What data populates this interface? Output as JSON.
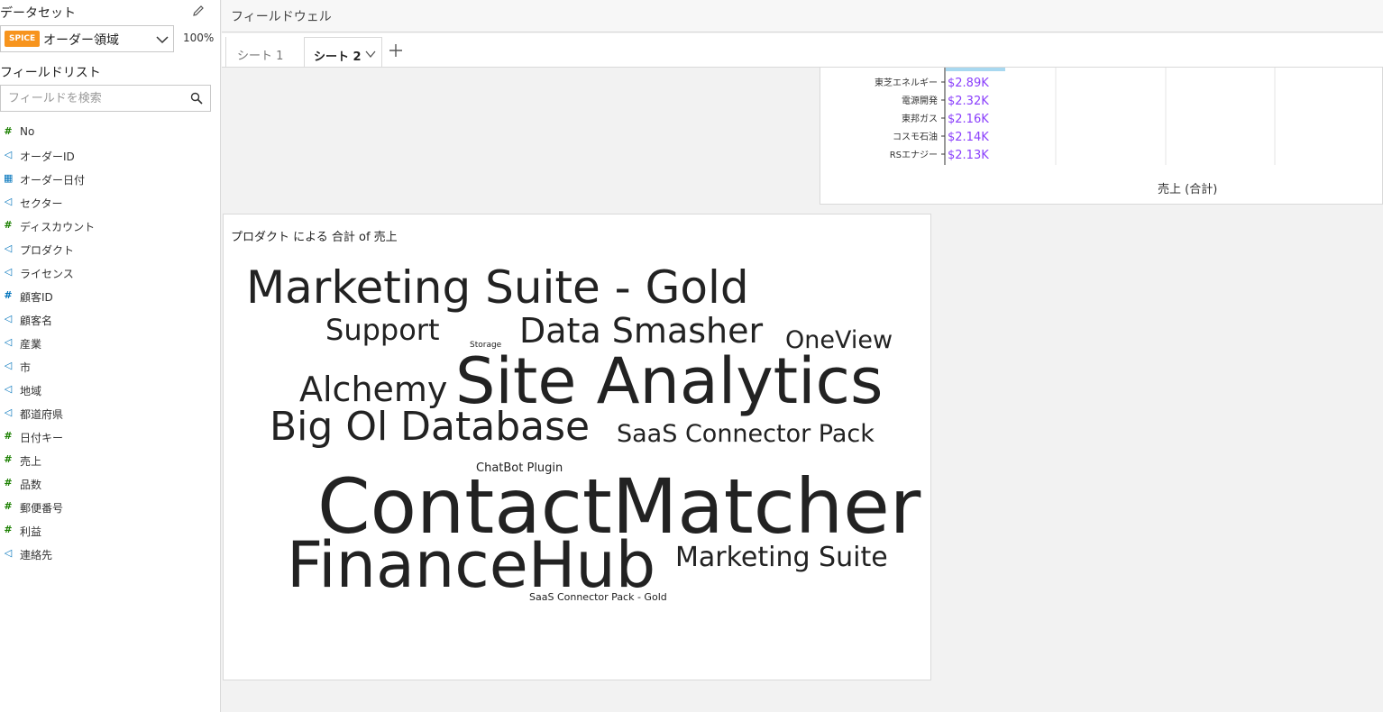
{
  "sidebar": {
    "dataset_title": "データセット",
    "dataset": {
      "badge": "SPICE",
      "name": "オーダー領域",
      "import_percent": "100%"
    },
    "field_list_title": "フィールドリスト",
    "search_placeholder": "フィールドを検索",
    "fields": [
      {
        "label": "No",
        "type": "measure",
        "icon": "hash-icon"
      },
      {
        "label": "オーダーID",
        "type": "dimension",
        "icon": "tag-icon"
      },
      {
        "label": "オーダー日付",
        "type": "date",
        "icon": "calendar-icon"
      },
      {
        "label": "セクター",
        "type": "dimension",
        "icon": "tag-icon"
      },
      {
        "label": "ディスカウント",
        "type": "measure",
        "icon": "hash-icon"
      },
      {
        "label": "プロダクト",
        "type": "dimension",
        "icon": "tag-icon"
      },
      {
        "label": "ライセンス",
        "type": "dimension",
        "icon": "tag-icon"
      },
      {
        "label": "顧客ID",
        "type": "dimension-numeric",
        "icon": "hash-icon"
      },
      {
        "label": "顧客名",
        "type": "dimension",
        "icon": "tag-icon"
      },
      {
        "label": "産業",
        "type": "dimension",
        "icon": "tag-icon"
      },
      {
        "label": "市",
        "type": "dimension",
        "icon": "tag-icon"
      },
      {
        "label": "地域",
        "type": "dimension",
        "icon": "tag-icon"
      },
      {
        "label": "都道府県",
        "type": "dimension",
        "icon": "tag-icon"
      },
      {
        "label": "日付キー",
        "type": "measure",
        "icon": "hash-icon"
      },
      {
        "label": "売上",
        "type": "measure",
        "icon": "hash-icon"
      },
      {
        "label": "品数",
        "type": "measure",
        "icon": "hash-icon"
      },
      {
        "label": "郵便番号",
        "type": "measure",
        "icon": "hash-icon"
      },
      {
        "label": "利益",
        "type": "measure",
        "icon": "hash-icon"
      },
      {
        "label": "連絡先",
        "type": "dimension",
        "icon": "tag-icon"
      }
    ]
  },
  "field_well": {
    "label": "フィールドウェル"
  },
  "tabs": [
    {
      "label": "シート 1",
      "active": false
    },
    {
      "label": "シート 2",
      "active": true
    }
  ],
  "colors": {
    "accent_orange": "#f7941d",
    "bar_fill": "#a8d8f0",
    "data_label": "#8a3ffc",
    "measure_icon": "#1d8102",
    "dimension_icon": "#0073bb"
  },
  "chart_data": [
    {
      "type": "bar",
      "orientation": "horizontal",
      "categories": [
        "東芝エネルギー",
        "電源開発",
        "東邦ガス",
        "コスモ石油",
        "RSエナジー"
      ],
      "values": [
        2890,
        2320,
        2160,
        2140,
        2130
      ],
      "data_labels": [
        "$2.89K",
        "$2.32K",
        "$2.16K",
        "$2.14K",
        "$2.13K"
      ],
      "xlabel": "売上 (合計)",
      "partially_visible": true
    },
    {
      "type": "wordcloud",
      "title": "プロダクト による 合計 of 売上",
      "words": [
        {
          "text": "ContactMatcher",
          "rank": 1
        },
        {
          "text": "Site Analytics",
          "rank": 2
        },
        {
          "text": "FinanceHub",
          "rank": 3
        },
        {
          "text": "Marketing Suite - Gold",
          "rank": 4
        },
        {
          "text": "Big Ol Database",
          "rank": 5
        },
        {
          "text": "Data Smasher",
          "rank": 6
        },
        {
          "text": "Alchemy",
          "rank": 7
        },
        {
          "text": "Support",
          "rank": 8
        },
        {
          "text": "Marketing Suite",
          "rank": 9
        },
        {
          "text": "SaaS Connector Pack",
          "rank": 10
        },
        {
          "text": "OneView",
          "rank": 11
        },
        {
          "text": "ChatBot Plugin",
          "rank": 12
        },
        {
          "text": "SaaS Connector Pack - Gold",
          "rank": 13
        },
        {
          "text": "Storage",
          "rank": 14
        }
      ]
    }
  ]
}
